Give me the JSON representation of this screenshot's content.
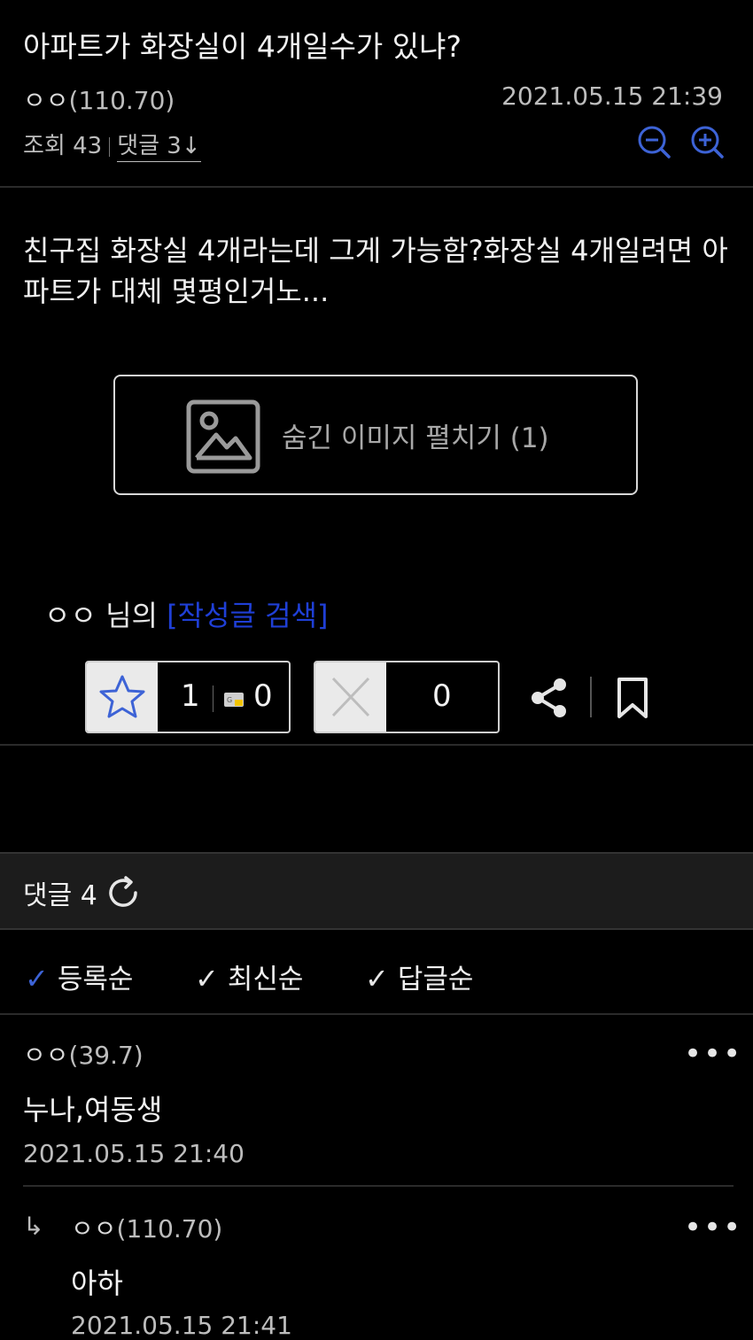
{
  "post": {
    "title": "아파트가 화장실이 4개일수가 있냐?",
    "author_name": "ㅇㅇ",
    "author_ip": "(110.70)",
    "datetime": "2021.05.15 21:39",
    "views_label": "조회 43",
    "comments_link": "댓글 3↓",
    "body": "친구집 화장실 4개라는데 그게 가능함?화장실 4개일려면 아파트가 대체 몇평인거노...",
    "hidden_image_label": "숨긴 이미지 펼치기 (1)"
  },
  "author_search": {
    "name": "ㅇㅇ",
    "suffix": " 님의 ",
    "link": "[작성글 검색]"
  },
  "votes": {
    "up_count": "1",
    "gold_count": "0",
    "down_count": "0"
  },
  "comments": {
    "header_label": "댓글 4",
    "sort_options": [
      "등록순",
      "최신순",
      "답글순"
    ],
    "items": [
      {
        "author": "ㅇㅇ",
        "ip": "(39.7)",
        "text": "누나,여동생",
        "datetime": "2021.05.15 21:40"
      },
      {
        "reply_marker": "↳",
        "author": "ㅇㅇ",
        "ip": "(110.70)",
        "text": "아하",
        "datetime": "2021.05.15 21:41"
      }
    ],
    "more_glyph": "•••"
  },
  "colors": {
    "link_blue": "#1f3fd6",
    "icon_blue": "#3d63d6",
    "background": "#000000"
  }
}
